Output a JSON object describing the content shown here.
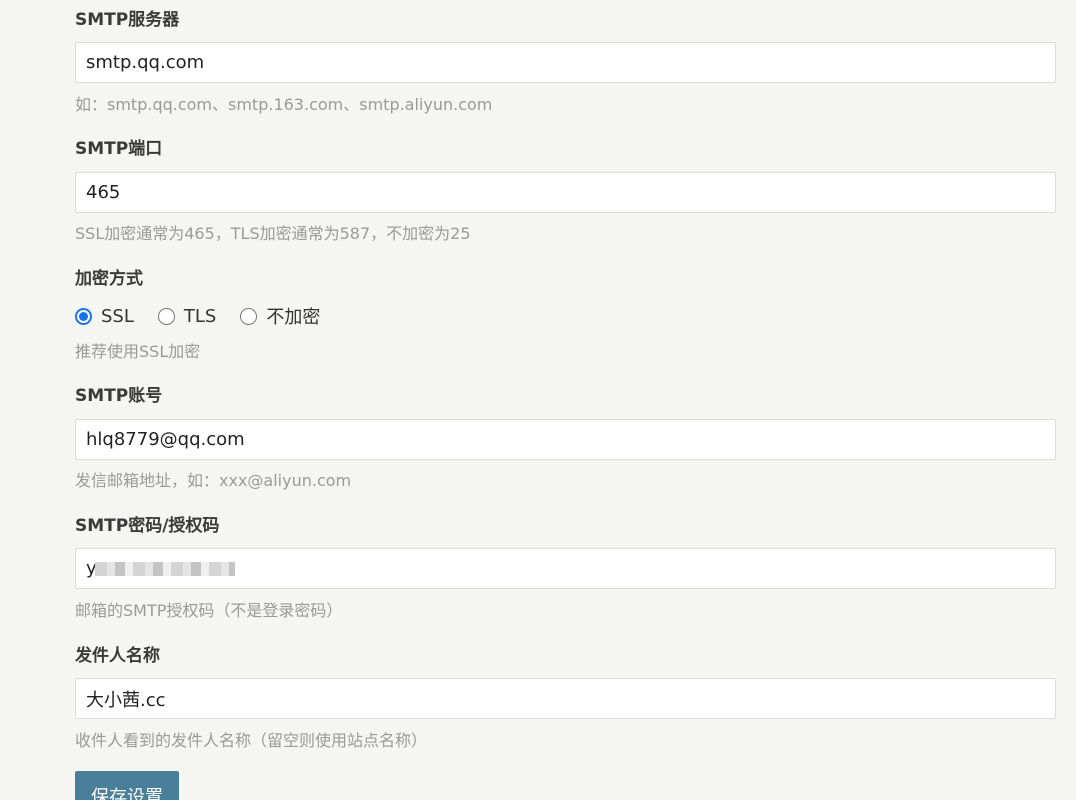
{
  "smtp_server": {
    "label": "SMTP服务器",
    "value": "smtp.qq.com",
    "hint": "如：smtp.qq.com、smtp.163.com、smtp.aliyun.com"
  },
  "smtp_port": {
    "label": "SMTP端口",
    "value": "465",
    "hint": "SSL加密通常为465，TLS加密通常为587，不加密为25"
  },
  "encryption": {
    "label": "加密方式",
    "options": [
      "SSL",
      "TLS",
      "不加密"
    ],
    "selected": "SSL",
    "hint": "推荐使用SSL加密"
  },
  "smtp_account": {
    "label": "SMTP账号",
    "value": "hlq8779@qq.com",
    "hint": "发信邮箱地址，如：xxx@aliyun.com"
  },
  "smtp_password": {
    "label": "SMTP密码/授权码",
    "value": "y",
    "hint": "邮箱的SMTP授权码（不是登录密码）"
  },
  "sender_name": {
    "label": "发件人名称",
    "value": "大小茜.cc",
    "hint": "收件人看到的发件人名称（留空则使用站点名称）"
  },
  "save_button": {
    "label": "保存设置"
  },
  "colors": {
    "background": "#f5f5f1",
    "button": "#4a7f9a",
    "radio_accent": "#1a73e8",
    "hint_text": "#9a9a9a"
  }
}
